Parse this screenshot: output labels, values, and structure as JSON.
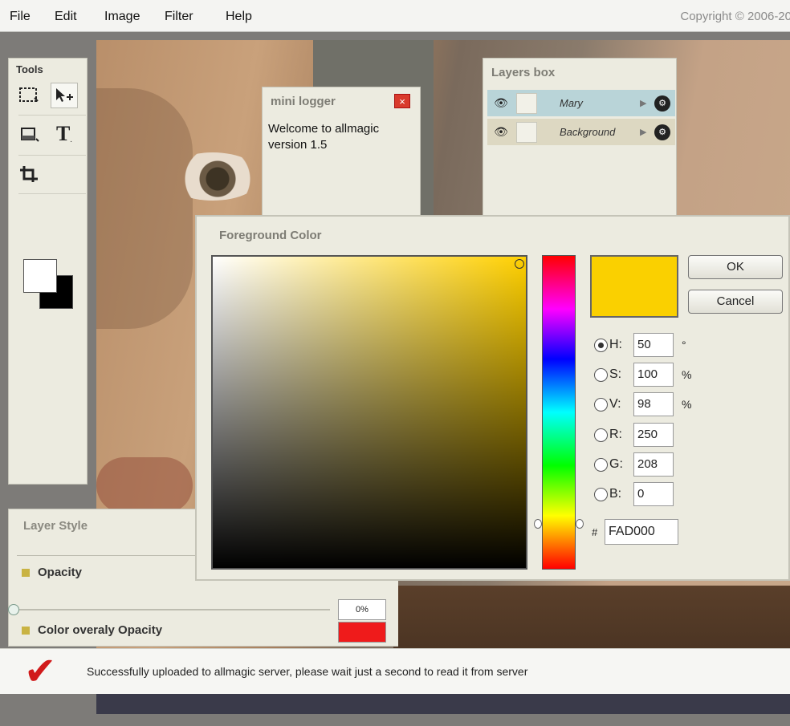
{
  "menu": {
    "items": [
      "File",
      "Edit",
      "Image",
      "Filter",
      "Help"
    ],
    "copyright": "Copyright © 2006-20"
  },
  "tools": {
    "title": "Tools",
    "items": [
      "marquee-select",
      "move",
      "eraser",
      "text",
      "crop"
    ],
    "foreground": "#ffffff",
    "background": "#000000"
  },
  "logger": {
    "title": "mini logger",
    "close": "×",
    "lines": [
      "Welcome to allmagic",
      "version 1.5"
    ]
  },
  "layers": {
    "title": "Layers box",
    "rows": [
      {
        "name": "Mary",
        "selected": true
      },
      {
        "name": "Background",
        "selected": false
      }
    ]
  },
  "layer_style": {
    "title": "Layer Style",
    "opacity_label": "Opacity",
    "color_overlay_label": "Color overaly Opacity",
    "opacity_value": "0%",
    "overlay_color": "#ef1b1b"
  },
  "color_dialog": {
    "title": "Foreground Color",
    "ok": "OK",
    "cancel": "Cancel",
    "preview_color": "#fad000",
    "fields": [
      {
        "label": "H:",
        "value": "50",
        "unit": "°",
        "selected": true
      },
      {
        "label": "S:",
        "value": "100",
        "unit": "%",
        "selected": false
      },
      {
        "label": "V:",
        "value": "98",
        "unit": "%",
        "selected": false
      },
      {
        "label": "R:",
        "value": "250",
        "unit": "",
        "selected": false
      },
      {
        "label": "G:",
        "value": "208",
        "unit": "",
        "selected": false
      },
      {
        "label": "B:",
        "value": "0",
        "unit": "",
        "selected": false
      }
    ],
    "hash": "#",
    "hex": "FAD000"
  },
  "status": {
    "check_icon": "check-mark-icon",
    "message": "Successfully uploaded to allmagic server, please wait just a second to read it from server"
  }
}
